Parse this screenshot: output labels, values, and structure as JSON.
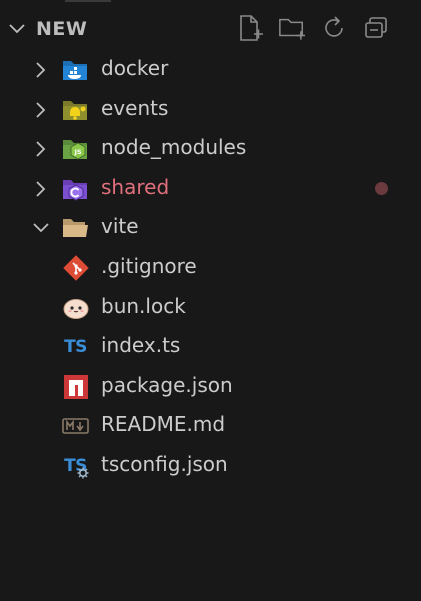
{
  "explorer": {
    "section_title": "NEW",
    "actions": [
      {
        "name": "new-file-icon"
      },
      {
        "name": "new-folder-icon"
      },
      {
        "name": "refresh-icon"
      },
      {
        "name": "collapse-all-icon"
      }
    ]
  },
  "tree": {
    "items": [
      {
        "label": "docker",
        "type": "folder",
        "expanded": false,
        "icon": "docker-folder-icon"
      },
      {
        "label": "events",
        "type": "folder",
        "expanded": false,
        "icon": "events-folder-icon"
      },
      {
        "label": "node_modules",
        "type": "folder",
        "expanded": false,
        "icon": "node-folder-icon"
      },
      {
        "label": "shared",
        "type": "folder",
        "expanded": false,
        "icon": "shared-folder-icon",
        "status": "modified"
      },
      {
        "label": "vite",
        "type": "folder",
        "expanded": true,
        "icon": "folder-open-icon"
      },
      {
        "label": ".gitignore",
        "type": "file",
        "icon": "git-icon"
      },
      {
        "label": "bun.lock",
        "type": "file",
        "icon": "bun-icon"
      },
      {
        "label": "index.ts",
        "type": "file",
        "icon": "typescript-icon",
        "icon_text": "TS"
      },
      {
        "label": "package.json",
        "type": "file",
        "icon": "npm-icon"
      },
      {
        "label": "README.md",
        "type": "file",
        "icon": "markdown-icon"
      },
      {
        "label": "tsconfig.json",
        "type": "file",
        "icon": "tsconfig-icon",
        "icon_text": "TS"
      }
    ]
  },
  "colors": {
    "background": "#181818",
    "text": "#cccccc",
    "modified_text": "#e0707c",
    "modified_dot": "#6b3a3f"
  }
}
